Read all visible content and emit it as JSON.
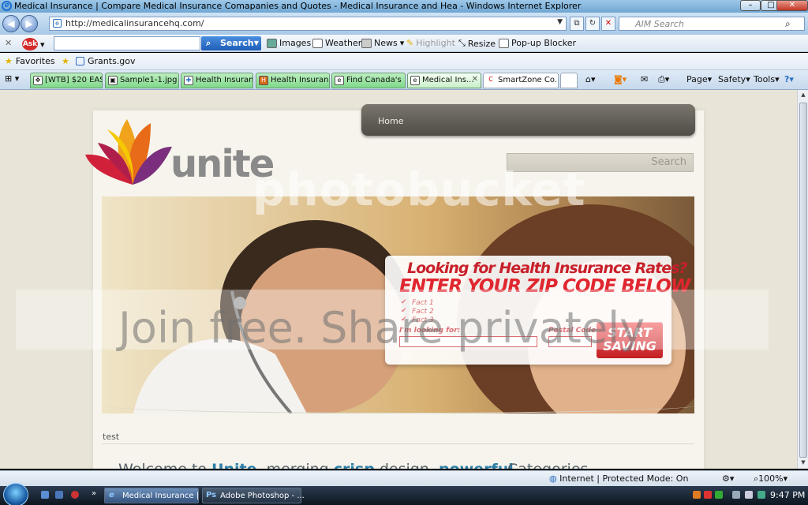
{
  "window": {
    "title": "Medical Insurance | Compare Medical Insurance Comapanies and Quotes - Medical Insurance and Hea - Windows Internet Explorer",
    "minimize": "–",
    "maximize": "□",
    "close": "✕"
  },
  "address": {
    "url": "http://medicalinsurancehq.com/",
    "search_placeholder": "AIM Search"
  },
  "ask_toolbar": {
    "logo": "Ask",
    "search_label": "Search",
    "items": [
      "Images",
      "Weather",
      "News",
      "Highlight",
      "Resize",
      "Pop-up Blocker"
    ]
  },
  "favorites": {
    "label": "Favorites",
    "links": [
      "Grants.gov"
    ]
  },
  "tabs": [
    "[WTB] $20 EAS...",
    "Sample1-1.jpg ...",
    "Health Insuran...",
    "Health Insuran...",
    "Find Canada's ...",
    "Medical Ins...",
    "SmartZone Co..."
  ],
  "commands": {
    "page": "Page",
    "safety": "Safety",
    "tools": "Tools"
  },
  "site": {
    "nav_home": "Home",
    "logo_text": "unite",
    "search_placeholder": "Search",
    "watermark_top": "photobucket",
    "watermark_band": "Join free. Share privately",
    "hero": {
      "headline": "Looking for Health Insurance Rates?",
      "subheadline": "ENTER YOUR ZIP CODE BELOW",
      "facts": [
        "Fact 1",
        "Fact 2",
        "Fact 3"
      ],
      "looking_label": "I'm looking for:",
      "postal_label": "Postal Code",
      "button": "START SAVING"
    },
    "test_text": "test",
    "welcome": {
      "p1": "Welcome to ",
      "unite": "Unite",
      "p2": ", merging ",
      "crisp": "crisp",
      "p3": " design, ",
      "powerful": "powerful"
    },
    "categories_heading": "Categories"
  },
  "status": {
    "zone": "Internet | Protected Mode: On",
    "zoom": "100%"
  },
  "taskbar": {
    "tasks": [
      "Medical Insurance | ...",
      "Adobe Photoshop - ..."
    ],
    "clock": "9:47 PM"
  },
  "colors": {
    "accent_red": "#e0262f",
    "nav_dark": "#5a5650",
    "link_blue": "#2e7fa8"
  }
}
